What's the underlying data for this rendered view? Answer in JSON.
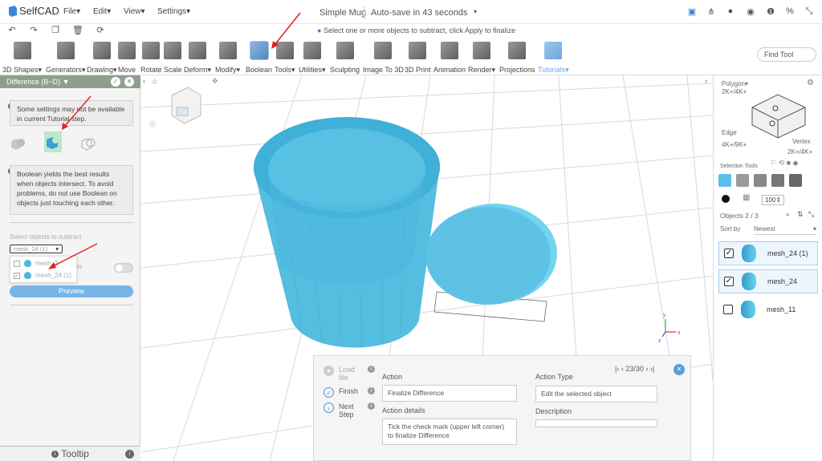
{
  "app": {
    "logo": "SelfCAD"
  },
  "menubar": {
    "items": [
      "File",
      "Edit",
      "View",
      "Settings"
    ],
    "project_name": "Simple Mug",
    "autosave": "Auto-save in 43 seconds",
    "hint": "Select one or more objects to subtract, click Apply to finalize"
  },
  "toolbar": {
    "tools": [
      {
        "label": "3D Shapes",
        "dropdown": true
      },
      {
        "label": "Generators",
        "dropdown": true
      },
      {
        "label": "Drawing",
        "dropdown": true
      },
      {
        "label": "Move"
      },
      {
        "label": "Rotate"
      },
      {
        "label": "Scale"
      },
      {
        "label": "Deform",
        "dropdown": true
      },
      {
        "label": "Modify",
        "dropdown": true
      },
      {
        "label": "Boolean",
        "active": true
      },
      {
        "label": "Tools",
        "dropdown": true
      },
      {
        "label": "Utilities",
        "dropdown": true
      },
      {
        "label": "Sculpting"
      },
      {
        "label": "Image To 3D"
      },
      {
        "label": "3D Print"
      },
      {
        "label": "Animation"
      },
      {
        "label": "Render",
        "dropdown": true
      },
      {
        "label": "Projections"
      },
      {
        "label": "Tutorials",
        "dropdown": true,
        "highlight": true
      }
    ],
    "find_tool": "Find Tool"
  },
  "left_panel": {
    "header": "Difference (B−D)",
    "settings_note": "Some settings may not be available in current Tutorial step.",
    "boolean_note": "Boolean yields the best results when objects intersect. To avoid problems, do not use Boolean on objects just touching each other.",
    "select_label": "Select objects to subtract",
    "dropdown_value": "mesh_24 (1)",
    "dropdown_items": [
      {
        "name": "mesh_2",
        "checked": false
      },
      {
        "name": "mesh_24 (1)",
        "checked": true
      }
    ],
    "hidden_option_fragment": "ts",
    "preview": "Preview",
    "tooltip": "Tooltip"
  },
  "right_panel": {
    "polygon": "Polygon",
    "polygon_count": "2K+/4K+",
    "edge": "Edge",
    "edge_count": "4K+/9K+",
    "vertex": "Vertex",
    "vertex_count": "2K+/4K+",
    "selection_tools": "Selection Tools",
    "size_value": "100",
    "objects_count": "Objects 2 / 3",
    "sort_label": "Sort by",
    "sort_value": "Newest",
    "objects": [
      {
        "name": "mesh_24 (1)",
        "checked": true
      },
      {
        "name": "mesh_24",
        "checked": true
      },
      {
        "name": "mesh_11",
        "checked": false
      }
    ]
  },
  "tutorial": {
    "steps": [
      "Load file",
      "Finish",
      "Next Step"
    ],
    "nav": "23/30",
    "action_label": "Action",
    "action_value": "Finalize Difference",
    "action_details_label": "Action details",
    "action_details_value": "Tick the check mark (upper left corner) to finalize Difference",
    "action_type_label": "Action Type",
    "action_type_value": "Edit the selected object",
    "description_label": "Description",
    "description_value": ""
  },
  "colors": {
    "accent": "#4a90d9",
    "mesh": "#55bde0",
    "panel_header": "#8f9f8f"
  }
}
